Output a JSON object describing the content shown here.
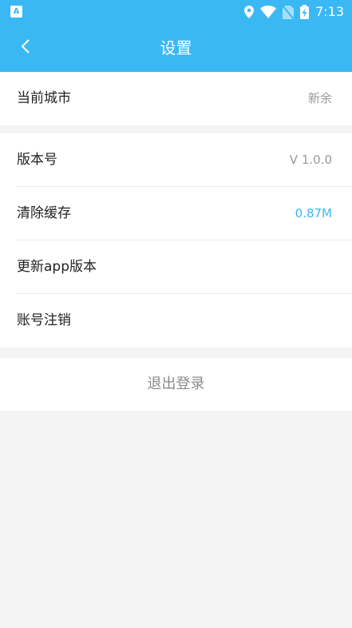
{
  "status_bar": {
    "left_icon_letter": "A",
    "time": "7:13",
    "icons": [
      "location-icon",
      "wifi-icon",
      "no-sim-icon",
      "battery-charging-icon"
    ]
  },
  "app_bar": {
    "back_icon": "chevron-left-icon",
    "title": "设置"
  },
  "city_section": {
    "label": "当前城市",
    "value": "新余"
  },
  "info_section": {
    "items": [
      {
        "label": "版本号",
        "value": "V 1.0.0"
      },
      {
        "label": "清除缓存",
        "value": "0.87M"
      },
      {
        "label": "更新app版本",
        "value": ""
      },
      {
        "label": "账号注销",
        "value": ""
      }
    ]
  },
  "logout_label": "退出登录",
  "colors": {
    "primary": "#3ab8f3",
    "background": "#f4f4f4",
    "value_text": "#999999"
  }
}
